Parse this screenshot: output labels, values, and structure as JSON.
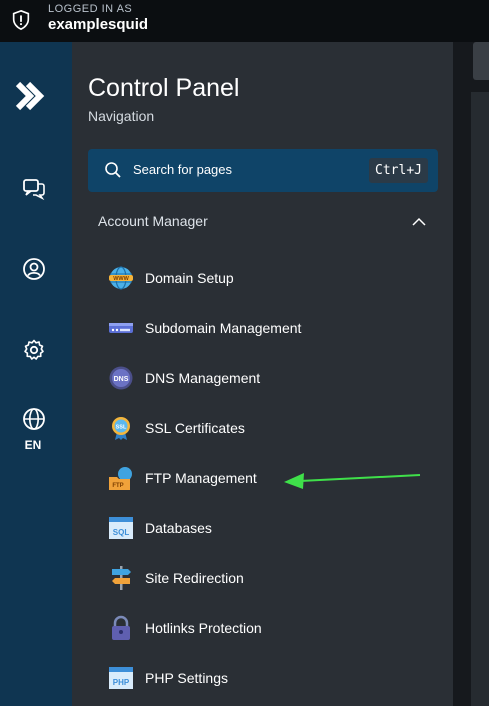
{
  "topbar": {
    "logged_in_label": "LOGGED IN AS",
    "username": "examplesquid"
  },
  "rail": {
    "items": [
      {
        "name": "chat-icon"
      },
      {
        "name": "user-icon"
      },
      {
        "name": "gear-icon"
      },
      {
        "name": "globe-icon"
      }
    ],
    "language": "EN"
  },
  "panel": {
    "title": "Control Panel",
    "subtitle": "Navigation",
    "search": {
      "placeholder": "Search for pages",
      "shortcut": "Ctrl+J"
    },
    "section": {
      "label": "Account Manager",
      "expanded": true
    },
    "items": [
      {
        "label": "Domain Setup",
        "icon": "www-globe-icon"
      },
      {
        "label": "Subdomain Management",
        "icon": "subdomain-icon"
      },
      {
        "label": "DNS Management",
        "icon": "dns-icon"
      },
      {
        "label": "SSL Certificates",
        "icon": "ssl-badge-icon"
      },
      {
        "label": "FTP Management",
        "icon": "ftp-folder-icon"
      },
      {
        "label": "Databases",
        "icon": "sql-window-icon"
      },
      {
        "label": "Site Redirection",
        "icon": "signpost-icon"
      },
      {
        "label": "Hotlinks Protection",
        "icon": "padlock-icon"
      },
      {
        "label": "PHP Settings",
        "icon": "php-window-icon"
      }
    ]
  },
  "annotation": {
    "arrow_color": "#3fe04a",
    "points_to": "FTP Management"
  },
  "colors": {
    "topbar": "#0b0e11",
    "rail": "#0f3551",
    "panel": "#2a2f35",
    "search": "#0f4468"
  }
}
